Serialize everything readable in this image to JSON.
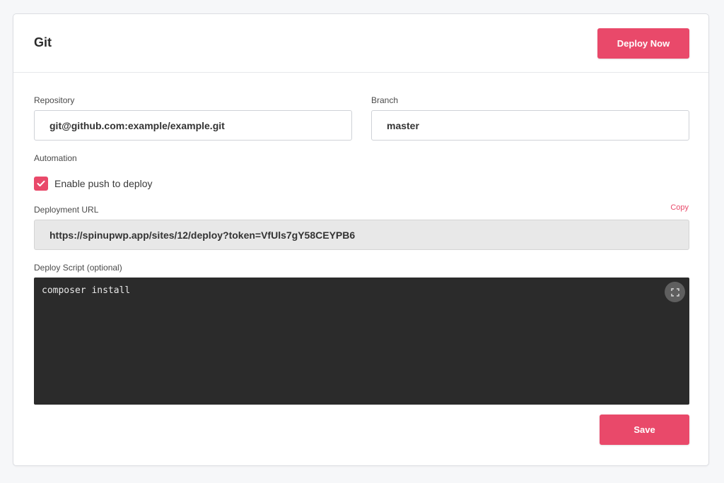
{
  "header": {
    "title": "Git",
    "deploy_label": "Deploy Now"
  },
  "form": {
    "repository_label": "Repository",
    "repository_value": "git@github.com:example/example.git",
    "branch_label": "Branch",
    "branch_value": "master",
    "automation_label": "Automation",
    "push_to_deploy_label": "Enable push to deploy",
    "push_to_deploy_checked": true,
    "deployment_url_label": "Deployment URL",
    "copy_label": "Copy",
    "deployment_url_value": "https://spinupwp.app/sites/12/deploy?token=VfUls7gY58CEYPB6",
    "deploy_script_label": "Deploy Script (optional)",
    "deploy_script_value": "composer install",
    "save_label": "Save"
  },
  "icons": {
    "checkbox": "check-icon",
    "editor_expand": "fullscreen-icon"
  },
  "colors": {
    "accent": "#e9496a",
    "editor_bg": "#2b2b2b",
    "readonly_bg": "#e8e8e8"
  }
}
